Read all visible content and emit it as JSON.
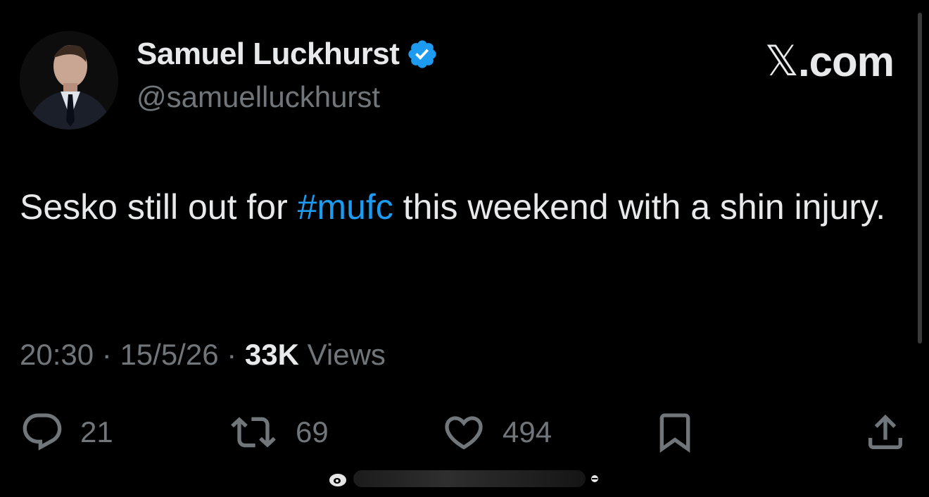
{
  "author": {
    "display_name": "Samuel Luckhurst",
    "handle": "@samuelluckhurst",
    "verified": true,
    "verified_color": "#1d9bf0"
  },
  "brand": {
    "x_glyph": "𝕏",
    "domain": ".com"
  },
  "tweet": {
    "text_before": "Sesko still out for ",
    "hashtag": "#mufc",
    "text_after": " this weekend with a shin injury.",
    "hashtag_color": "#1d9bf0"
  },
  "meta": {
    "time": "20:30",
    "separator": " · ",
    "date": "15/5/26",
    "views_count": "33K",
    "views_label": "Views"
  },
  "actions": {
    "replies": "21",
    "reposts": "69",
    "likes": "494"
  },
  "icons": [
    "reply-icon",
    "repost-icon",
    "like-icon",
    "bookmark-icon",
    "share-icon",
    "verified-badge-icon"
  ],
  "colors": {
    "background": "#000000",
    "text_primary": "#e7e9ea",
    "text_secondary": "#71767b",
    "accent": "#1d9bf0"
  }
}
